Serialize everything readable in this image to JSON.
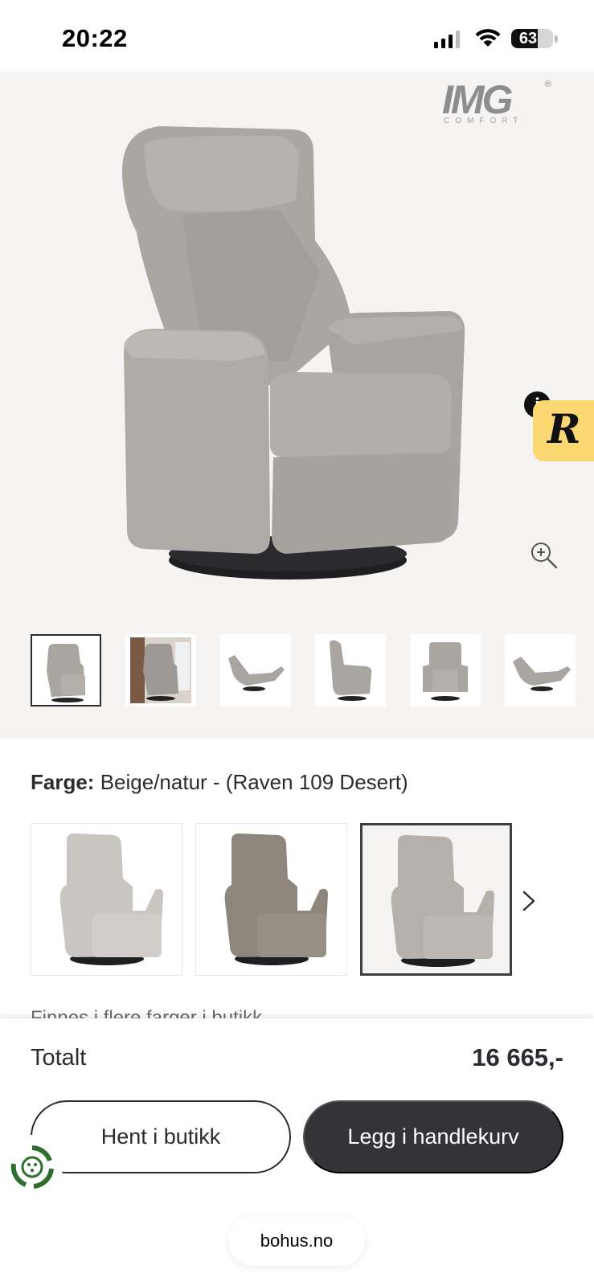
{
  "status_bar": {
    "time": "20:22",
    "battery_percent": "63",
    "battery_level": 0.63
  },
  "gallery": {
    "brand": {
      "name": "IMG",
      "subtitle": "COMFORT",
      "mark": "®"
    },
    "review_badge": {
      "info": "i",
      "letter": "R"
    },
    "thumbnails": [
      {
        "name": "front-view",
        "active": true
      },
      {
        "name": "room-view",
        "active": false
      },
      {
        "name": "reclined-side-view",
        "active": false
      },
      {
        "name": "side-view",
        "active": false
      },
      {
        "name": "front-straight-view",
        "active": false
      },
      {
        "name": "reclined-view",
        "active": false
      }
    ],
    "icons": {
      "zoom": "zoom-in-icon",
      "next": "chevron-right-icon"
    }
  },
  "color": {
    "label": "Farge:",
    "value": "Beige/natur - (Raven 109 Desert)",
    "options": [
      {
        "name": "light-grey",
        "color": "#c9c6c1",
        "selected": false
      },
      {
        "name": "taupe",
        "color": "#8e857c",
        "selected": false
      },
      {
        "name": "beige-natur",
        "color": "#b5b0a9",
        "selected": true
      }
    ],
    "availability_text": "Finnes i flere farger i butikk"
  },
  "checkout": {
    "total_label": "Totalt",
    "total_price": "16 665,-",
    "pickup_button": "Hent i butikk",
    "cart_button": "Legg i handlekurv"
  },
  "browser": {
    "url": "bohus.no"
  },
  "colors": {
    "accent_dark": "#333338",
    "hero_bg": "#f5f4f2",
    "badge_yellow": "#fcd873"
  }
}
